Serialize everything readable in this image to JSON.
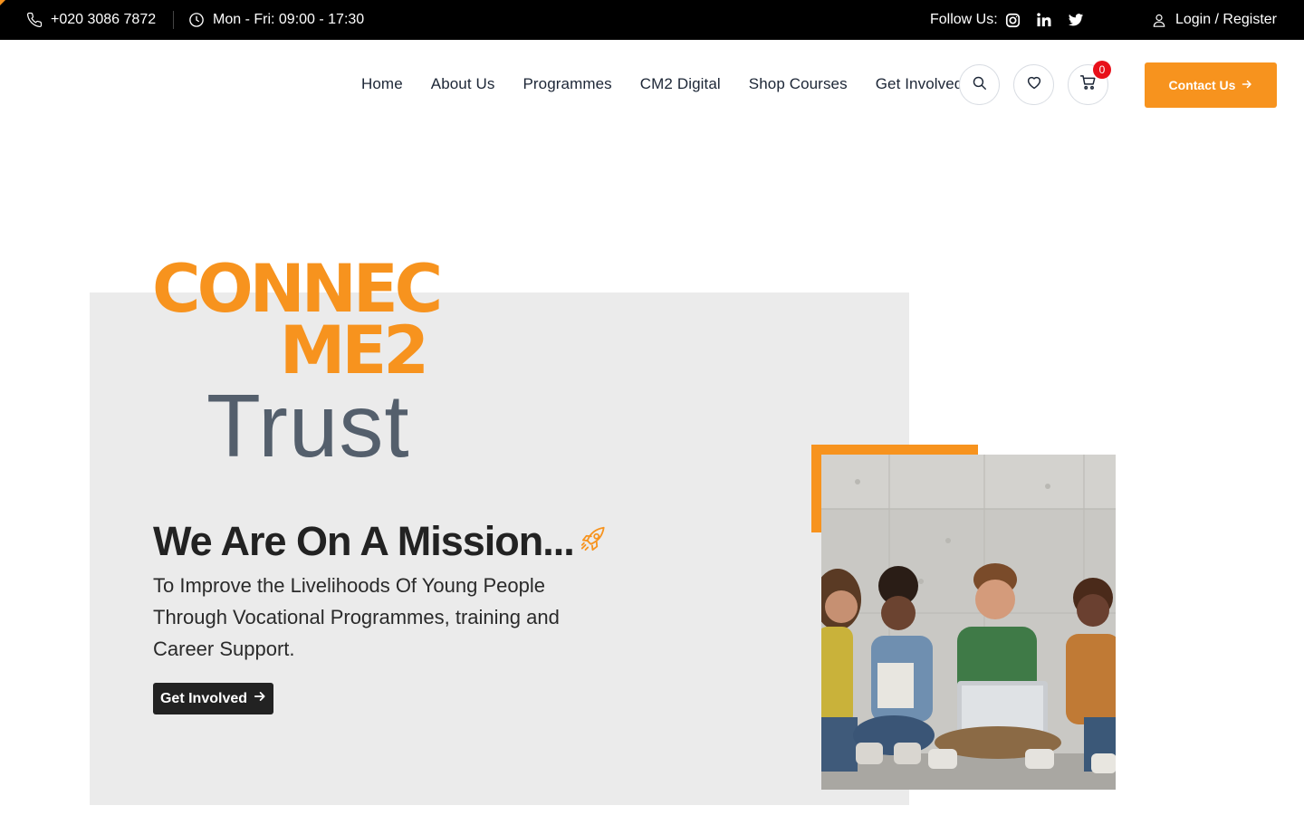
{
  "topbar": {
    "phone": "+020 3086 7872",
    "hours": "Mon - Fri: 09:00 - 17:30",
    "follow_label": "Follow Us:",
    "social_icons": [
      "instagram-icon",
      "linkedin-icon",
      "twitter-icon"
    ],
    "login_label": "Login / Register"
  },
  "nav": {
    "items": [
      "Home",
      "About Us",
      "Programmes",
      "CM2 Digital",
      "Shop Courses",
      "Get Involved"
    ]
  },
  "header": {
    "icons": [
      "search-icon",
      "heart-icon",
      "cart-icon"
    ],
    "cart_count": "0",
    "contact_label": "Contact Us"
  },
  "logo": {
    "line1": "CONNEC",
    "line2": "ME2",
    "line3": "Trust"
  },
  "hero": {
    "heading": "We Are On A Mission...",
    "description": "To Improve the Livelihoods Of Young People Through Vocational Programmes, training and Career Support.",
    "cta_label": "Get Involved"
  },
  "colors": {
    "accent": "#f7931e",
    "topbar_bg": "#000000",
    "panel_bg": "#ebebeb",
    "logo_grey": "#545f6c",
    "badge": "#e8101a"
  }
}
